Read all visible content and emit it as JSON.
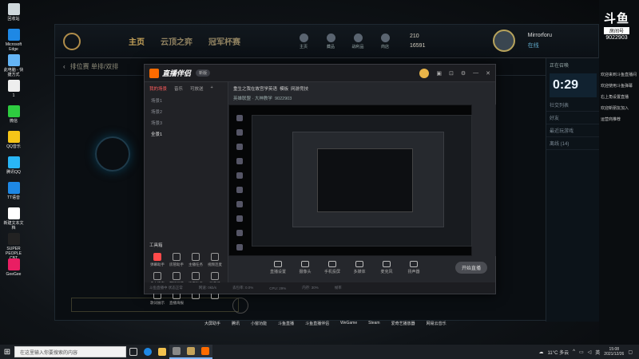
{
  "desktop_icons": [
    {
      "label": "回收站",
      "color": "#cfd8dc"
    },
    {
      "label": "Microsoft Edge",
      "color": "#1e88e5"
    },
    {
      "label": "此电脑 - 快捷方式",
      "color": "#64b5f6"
    },
    {
      "label": "1",
      "color": "#eeeeee"
    },
    {
      "label": "微信",
      "color": "#2ecc40"
    },
    {
      "label": "QQ音乐",
      "color": "#f5c518"
    },
    {
      "label": "腾讯QQ",
      "color": "#29b6f6"
    },
    {
      "label": "TT语音",
      "color": "#1e88e5"
    },
    {
      "label": "新建文本文档",
      "color": "#ffffff"
    },
    {
      "label": "SUPER PEOPLE CBT",
      "color": "#222222"
    },
    {
      "label": "GeeGee",
      "color": "#e91e63"
    }
  ],
  "lol": {
    "tabs": [
      "主页",
      "云顶之弈",
      "冠军杯赛"
    ],
    "icons": [
      "主页",
      "藏品",
      "战利品",
      "商店"
    ],
    "currency_be": "210",
    "currency_rp": "16591",
    "username": "Mirrorforu",
    "status": "在线",
    "subheader": "排位赛 单排/双排",
    "right_panel": {
      "room_label": "正在召唤",
      "timer": "0:29",
      "social_label": "社交列表",
      "rows": [
        "好友",
        "最近玩游戏",
        "离线 (14)"
      ]
    }
  },
  "assistant": {
    "app_name": "直播伴侣",
    "version": "新版",
    "left_tabs": [
      "我的场景",
      "音乐",
      "可放送"
    ],
    "scenes": [
      "场景1",
      "场景2",
      "场景3",
      "全景1"
    ],
    "tools_title": "工具箱",
    "tools": [
      "弹幕助手",
      "房管助手",
      "主播任务",
      "视频连麦",
      "多人连麦",
      "游戏弹幕",
      "语音助手",
      "弹幕墙",
      "歌词展示",
      "直播海报",
      "",
      ""
    ],
    "stream_title": "重生之我在故宫学英语",
    "stream_tag": "模板",
    "category": "网游竞技",
    "room_line": "英雄联盟 · 大神教学",
    "room_id": "9022903",
    "controls": [
      "直播设置",
      "摄像头",
      "手机投屏",
      "多媒体",
      "麦克风",
      "扬声器"
    ],
    "start_label": "开始直播",
    "status_items": [
      "斗鱼直播中 状态正常",
      "网速: 0kb/s",
      "丢包率: 0.0%",
      "CPU: 29%",
      "内存: 30%",
      "帧率"
    ]
  },
  "douyu": {
    "brand": "斗鱼",
    "room_label": "房间号",
    "room_number": "9022903",
    "messages": [
      "欢迎来到斗鱼直播间",
      "欢迎使用斗鱼弹幕",
      "右上角设置直播",
      "欢迎新朋友加入",
      "运营商推荐"
    ]
  },
  "below_labels": [
    "大屏助手",
    "腾讯",
    "小窗功能",
    "斗鱼直播",
    "斗鱼直播伴侣",
    "WeGame",
    "Steam",
    "爱奇艺播放器",
    "网易云音乐"
  ],
  "taskbar": {
    "search_placeholder": "在这里输入你要搜索的内容",
    "weather": "11°C 多云",
    "ime": "英",
    "time": "15:08",
    "date": "2021/12/26"
  }
}
